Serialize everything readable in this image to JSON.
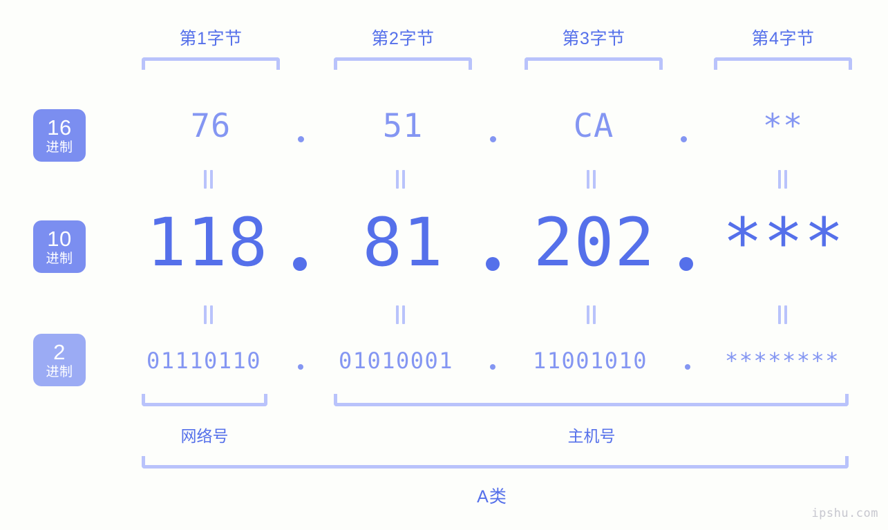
{
  "meta": {
    "watermark": "ipshu.com",
    "accent": "#5570ea",
    "accent_light": "#8496f2",
    "bracket": "#b9c3fb",
    "badge": "#7b8ef0",
    "badge_light": "#9babf4",
    "background": "#fdfefb"
  },
  "byte_headers": [
    {
      "label": "第1字节"
    },
    {
      "label": "第2字节"
    },
    {
      "label": "第3字节"
    },
    {
      "label": "第4字节"
    }
  ],
  "bases": [
    {
      "number": "16",
      "unit": "进制"
    },
    {
      "number": "10",
      "unit": "进制"
    },
    {
      "number": "2",
      "unit": "进制"
    }
  ],
  "rows": {
    "hex": {
      "values": [
        "76",
        "51",
        "CA",
        "**"
      ],
      "separator": "."
    },
    "decimal": {
      "values": [
        "118",
        "81",
        "202",
        "***"
      ],
      "separator": "."
    },
    "binary": {
      "values": [
        "01110110",
        "01010001",
        "11001010",
        "********"
      ],
      "separator": "."
    }
  },
  "sections": [
    {
      "label": "网络号"
    },
    {
      "label": "主机号"
    }
  ],
  "class": {
    "label": "A类"
  }
}
